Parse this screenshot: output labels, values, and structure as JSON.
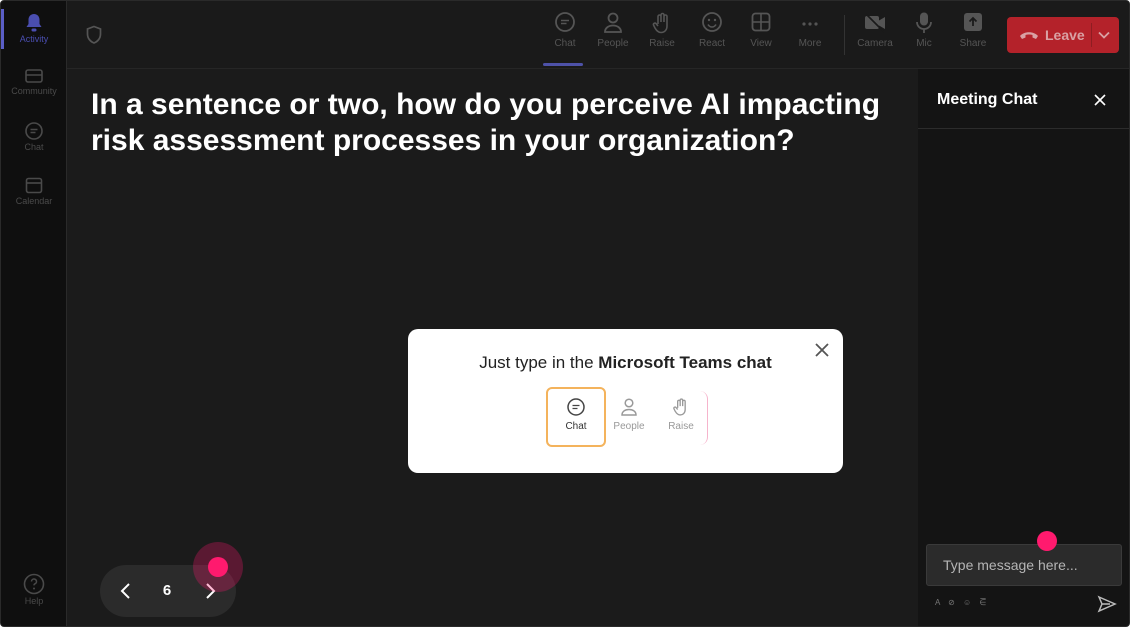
{
  "rail": {
    "items": [
      {
        "label": "Activity",
        "icon": "bell-icon"
      },
      {
        "label": "Community",
        "icon": "community-icon"
      },
      {
        "label": "Chat",
        "icon": "chat-icon"
      },
      {
        "label": "Calendar",
        "icon": "calendar-icon"
      }
    ],
    "help_label": "Help"
  },
  "toolbar": {
    "items": [
      {
        "label": "Chat",
        "icon": "chat-icon"
      },
      {
        "label": "People",
        "icon": "people-icon"
      },
      {
        "label": "Raise",
        "icon": "hand-icon"
      },
      {
        "label": "React",
        "icon": "smiley-icon"
      },
      {
        "label": "View",
        "icon": "grid-icon"
      },
      {
        "label": "More",
        "icon": "more-icon"
      },
      {
        "label": "Camera",
        "icon": "camera-icon"
      },
      {
        "label": "Mic",
        "icon": "mic-icon"
      },
      {
        "label": "Share",
        "icon": "share-icon"
      }
    ],
    "leave_label": "Leave",
    "leave_color": "#b4222a"
  },
  "question": "In a sentence or two, how do you perceive AI impacting risk assessment processes in your organization?",
  "popup": {
    "message_prefix": "Just type in the ",
    "message_bold": "Microsoft Teams chat",
    "items": [
      {
        "label": "Chat",
        "icon": "chat-icon"
      },
      {
        "label": "People",
        "icon": "people-icon"
      },
      {
        "label": "Raise",
        "icon": "hand-icon"
      }
    ],
    "highlight_color": "#f4b35c"
  },
  "pager": {
    "page": "6"
  },
  "chat_panel": {
    "title": "Meeting Chat",
    "input_placeholder": "Type message here...",
    "format_icons": "A ⊘ ☺ ⋶"
  },
  "colors": {
    "accent": "#5b5fc7",
    "cursor": "#ff1a6e"
  }
}
